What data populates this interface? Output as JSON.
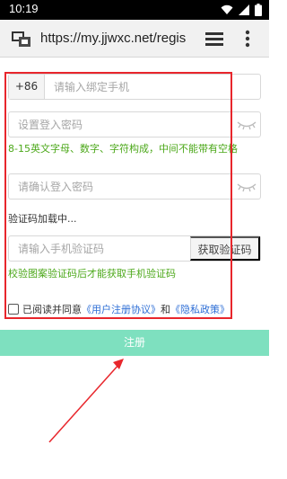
{
  "status_bar": {
    "time": "10:19"
  },
  "browser": {
    "url": "https://my.jjwxc.net/regis"
  },
  "form": {
    "country_code": "+86",
    "phone_placeholder": "请输入绑定手机",
    "password_placeholder": "设置登入密码",
    "password_hint": "8-15英文字母、数字、字符构成，中间不能带有空格",
    "confirm_placeholder": "请确认登入密码",
    "captcha_loading": "验证码加载中...",
    "sms_placeholder": "请输入手机验证码",
    "sms_button": "获取验证码",
    "sms_hint": "校验图案验证码后才能获取手机验证码",
    "agree_prefix": "已阅读并同意",
    "user_agreement": "《用户注册协议》",
    "and": "和",
    "privacy_policy": "《隐私政策》",
    "register_button": "注册"
  },
  "colors": {
    "accent_green": "#4ca81a",
    "link_blue": "#2f6fd6",
    "register_bg": "#7ee0bf",
    "annotation_red": "#e8262c"
  },
  "icons": [
    "signal-icon",
    "wifi-icon",
    "battery-icon",
    "site-icon",
    "tabs-icon",
    "more-menu-icon",
    "eye-closed-icon"
  ]
}
